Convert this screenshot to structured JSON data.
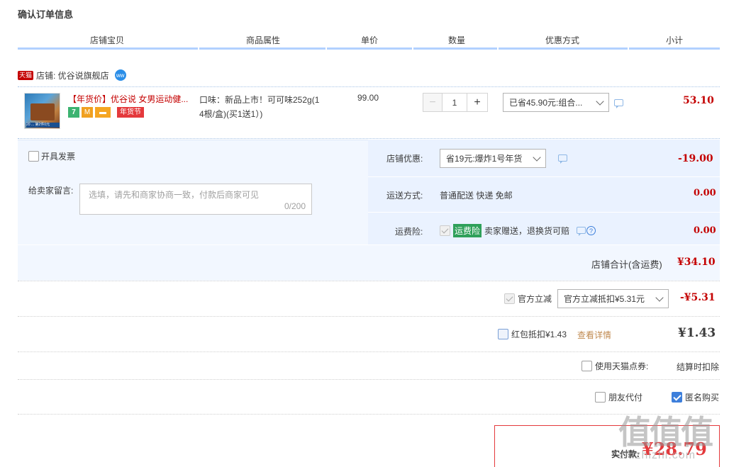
{
  "page_title": "确认订单信息",
  "columns": [
    "店铺宝贝",
    "商品属性",
    "单价",
    "数量",
    "优惠方式",
    "小计"
  ],
  "shop": {
    "tmall_badge": "天猫",
    "label": "店铺: 优谷说旗舰店",
    "ww_badge": "ww"
  },
  "item": {
    "name": "【年货价】优谷说 女男运动健...",
    "badge_7": "7",
    "badge_m": "M",
    "badge_festival": "年货节",
    "thumb_label": "20 ... 第2件0元",
    "attr_line1": "口味：新品上市！可可味252g(1",
    "attr_line2": "4根/盒)(买1送1）)",
    "price": "99.00",
    "qty": "1",
    "qty_minus": "−",
    "qty_plus": "+",
    "discount": "已省45.90元:组合...",
    "subtotal": "53.10"
  },
  "invoice_label": "开具发票",
  "message": {
    "label": "给卖家留言:",
    "placeholder": "选填，请先和商家协商一致，付款后商家可见",
    "counter": "0/200"
  },
  "shop_discount": {
    "label": "店铺优惠:",
    "value": "省19元:爆炸1号年货",
    "amount": "-19.00"
  },
  "shipping": {
    "label": "运送方式:",
    "value": "普通配送 快递 免邮",
    "amount": "0.00"
  },
  "insurance": {
    "label": "运费险:",
    "tag": "运费险",
    "value": "卖家赠送，退换货可赔",
    "amount": "0.00"
  },
  "shop_total": {
    "label": "店铺合计(含运费)",
    "amount": "¥34.10"
  },
  "official_discount": {
    "label": "官方立减",
    "value": "官方立减抵扣¥5.31元",
    "amount": "-¥5.31"
  },
  "redpacket": {
    "label": "红包抵扣¥1.43",
    "link": "查看详情",
    "amount": "¥1.43"
  },
  "tmall_points": {
    "label": "使用天猫点券:",
    "value": "结算时扣除"
  },
  "friend_pay": "朋友代付",
  "anonymous": "匿名购买",
  "final": {
    "label": "实付款:",
    "amount": "¥28.79"
  },
  "watermark": {
    "big": "值值值",
    "small": "zhizhizhi.com"
  },
  "colors": {
    "accent_red": "#c40000",
    "header_line": "#b2d1ff",
    "panel_bg": "#f2f7ff",
    "checkbox_blue": "#3d7fdb"
  }
}
